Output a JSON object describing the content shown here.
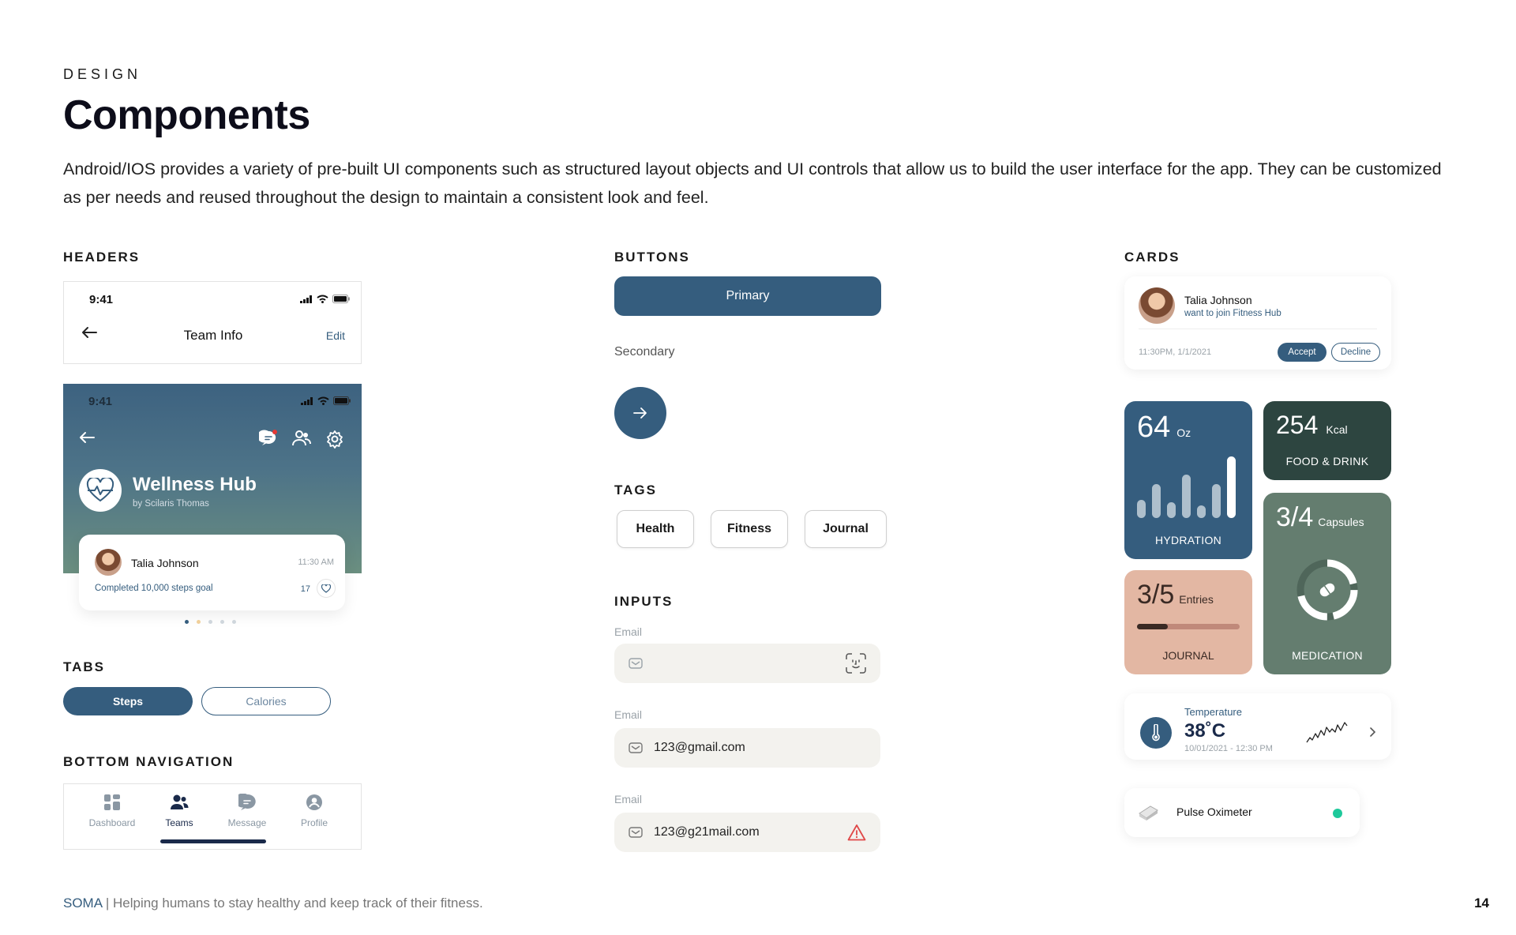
{
  "page": {
    "eyebrow": "DESIGN",
    "title": "Components",
    "description": "Android/IOS provides a variety of pre-built UI components such as structured layout objects and UI controls that allow us to build the user interface for the app. They can be customized as per needs and reused throughout the design to maintain a consistent look and feel."
  },
  "sections": {
    "headers": "HEADERS",
    "tabs": "TABS",
    "bottom_nav": "BOTTOM NAVIGATION",
    "buttons": "BUTTONS",
    "tags": "TAGS",
    "inputs": "INPUTS",
    "cards": "CARDS"
  },
  "header1": {
    "time": "9:41",
    "title": "Team Info",
    "edit": "Edit"
  },
  "header2": {
    "time": "9:41",
    "hub_name": "Wellness Hub",
    "hub_by": "by Scilaris Thomas",
    "notif_name": "Talia Johnson",
    "notif_time": "11:30 AM",
    "notif_text": "Completed 10,000 steps goal",
    "notif_likes": "17"
  },
  "tabs": {
    "active": "Steps",
    "inactive": "Calories"
  },
  "bottom_nav": [
    {
      "label": "Dashboard",
      "icon": "dashboard-icon",
      "active": false
    },
    {
      "label": "Teams",
      "icon": "teams-icon",
      "active": true
    },
    {
      "label": "Message",
      "icon": "message-icon",
      "active": false
    },
    {
      "label": "Profile",
      "icon": "profile-icon",
      "active": false
    }
  ],
  "buttons": {
    "primary": "Primary",
    "secondary": "Secondary"
  },
  "tags": [
    "Health",
    "Fitness",
    "Journal"
  ],
  "inputs": [
    {
      "label": "Email",
      "value": "",
      "state": "empty"
    },
    {
      "label": "Email",
      "value": "123@gmail.com",
      "state": "filled"
    },
    {
      "label": "Email",
      "value": "123@g21mail.com",
      "state": "error"
    }
  ],
  "cards": {
    "invite": {
      "name": "Talia Johnson",
      "text": "want to join Fitness Hub",
      "time": "11:30PM, 1/1/2021",
      "accept": "Accept",
      "decline": "Decline"
    },
    "hydration": {
      "value": "64",
      "unit": "Oz",
      "label": "HYDRATION",
      "bars": [
        0.3,
        0.55,
        0.25,
        0.7,
        0.2,
        0.55,
        1.0
      ]
    },
    "food": {
      "value": "254",
      "unit": "Kcal",
      "label": "FOOD & DRINK"
    },
    "medication": {
      "value": "3/4",
      "unit": "Capsules",
      "label": "MEDICATION",
      "progress": 0.75
    },
    "journal": {
      "value": "3/5",
      "unit": "Entries",
      "label": "JOURNAL",
      "progress": 0.3
    },
    "temperature": {
      "label": "Temperature",
      "value": "38˚C",
      "date": "10/01/2021 - 12:30 PM"
    },
    "pulse": {
      "label": "Pulse Oximeter"
    }
  },
  "colors": {
    "primary": "#355d7e",
    "food": "#2d4540",
    "medication": "#647d6f",
    "journal": "#e3b7a3",
    "status_ok": "#1ec99b",
    "error": "#e04848"
  },
  "footer": {
    "brand": "SOMA",
    "tagline": " | Helping humans to stay healthy and keep track of their fitness.",
    "page_number": "14"
  }
}
